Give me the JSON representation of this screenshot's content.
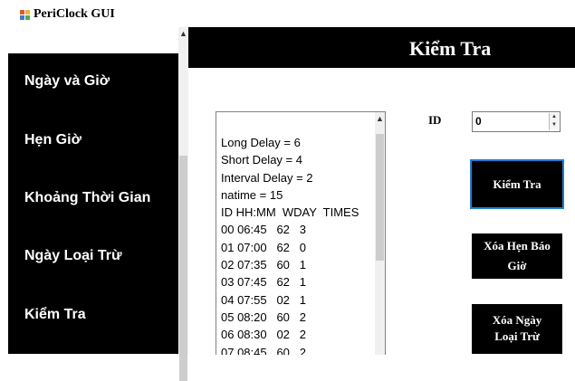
{
  "window": {
    "title": "PeriClock GUI"
  },
  "sidebar": {
    "items": [
      {
        "label": "Ngày và Giờ"
      },
      {
        "label": "Hẹn Giờ"
      },
      {
        "label": "Khoảng Thời Gian"
      },
      {
        "label": "Ngày Loại Trừ"
      },
      {
        "label": "Kiểm Tra"
      }
    ]
  },
  "header": {
    "title": "Kiểm Tra"
  },
  "listbox": {
    "lines": [
      "Long Delay = 6",
      "Short Delay = 4",
      "Interval Delay = 2",
      "natime = 15",
      "ID HH:MM  WDAY  TIMES",
      "00 06:45   62   3",
      "01 07:00   62   0",
      "02 07:35   60   1",
      "03 07:45   62   1",
      "04 07:55   02   1",
      "05 08:20   60   2",
      "06 08:30   02   2",
      "07 08:45   60   2"
    ]
  },
  "id_control": {
    "label": "ID",
    "value": "0"
  },
  "buttons": {
    "check": "Kiểm Tra",
    "clear_alarm_line1": "Xóa Hẹn Báo",
    "clear_alarm_line2": "Giờ",
    "clear_day_line1": "Xóa Ngày",
    "clear_day_line2": "Loại Trừ"
  },
  "colors": {
    "panel": "#000000",
    "selected_border": "#1c7fd8"
  }
}
